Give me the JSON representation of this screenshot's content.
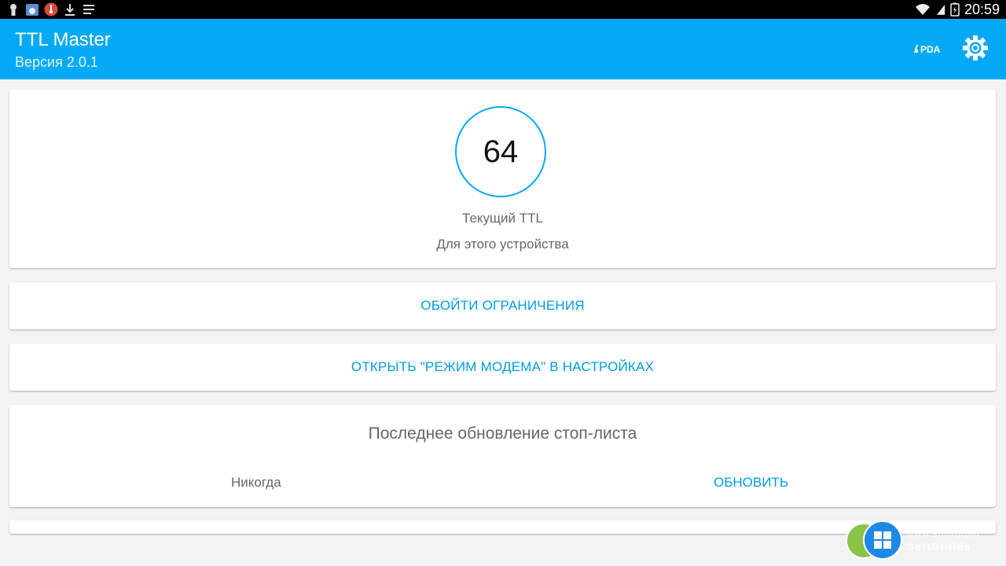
{
  "status_bar": {
    "time": "20:59",
    "left_icons": [
      "keyhole-icon",
      "cloud-app-icon",
      "thermometer-icon",
      "download-icon",
      "notes-icon"
    ],
    "right_icons": [
      "wifi-icon",
      "signal-icon",
      "battery-icon"
    ]
  },
  "app_bar": {
    "title": "TTL Master",
    "subtitle": "Версия 2.0.1",
    "logo_text": "4PDA",
    "settings_icon": "gear-icon",
    "background_color": "#03a9f4"
  },
  "ttl_card": {
    "value": "64",
    "label": "Текущий TTL",
    "sublabel": "Для этого устройства",
    "accent_color": "#03a9f4"
  },
  "actions": {
    "bypass_label": "ОБОЙТИ ОГРАНИЧЕНИЯ",
    "modem_settings_label": "ОТКРЫТЬ \"РЕЖИМ МОДЕМА\" В НАСТРОЙКАХ",
    "link_color": "#039be5"
  },
  "stoplist_card": {
    "title": "Последнее обновление стоп-листа",
    "last_update_value": "Никогда",
    "update_button_label": "ОБНОВИТЬ"
  },
  "watermark": {
    "line1": "www.soft-droid",
    "line2": "SoftDroids"
  }
}
